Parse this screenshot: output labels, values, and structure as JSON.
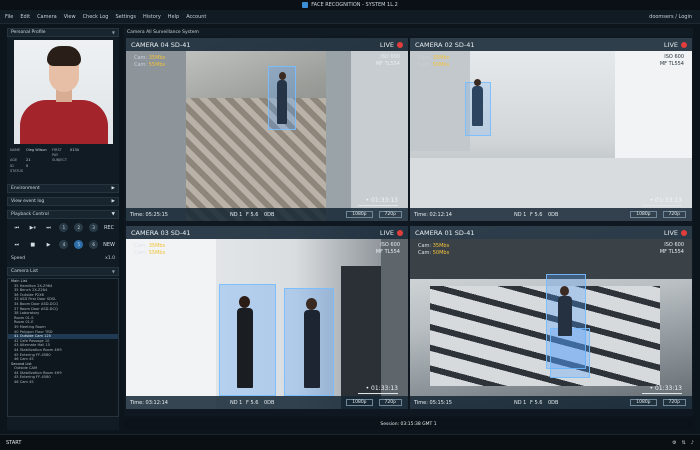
{
  "app": {
    "title": "FACE RECOGNITION - SYSTEM 1L.2",
    "user": "doomsers / Login"
  },
  "menu": [
    "File",
    "Edit",
    "Camera",
    "View",
    "Check Log",
    "Settings",
    "History",
    "Help",
    "Account"
  ],
  "left": {
    "profile_title": "Personal Profile",
    "info": [
      [
        "NAME",
        "Oleg Wilson",
        "FIRST PAY",
        "0134"
      ],
      [
        "AGE",
        "21",
        "SUBJECT",
        ""
      ],
      [
        "ID",
        "0",
        "",
        ""
      ],
      [
        "STATUS",
        "",
        "",
        ""
      ]
    ],
    "environment": "Environment",
    "view_event": "View event log",
    "playback": "Playback Control",
    "transport_row1": [
      "⏮",
      "▶⏸",
      "⏭",
      "1",
      "2",
      "3",
      "REC"
    ],
    "transport_row2": [
      "⏭",
      "■",
      "▶",
      "4",
      "5",
      "6",
      "NEW"
    ],
    "speed_label": "Speed",
    "speed_value": "x1.0",
    "camera_list_title": "Camera List",
    "camera_list": [
      {
        "label": "Main List",
        "grp": true
      },
      {
        "label": "35 Hamilton 2X-Z964"
      },
      {
        "label": "35 Bench 2X-Z264"
      },
      {
        "label": "36 Outside P2X6"
      },
      {
        "label": "33 ASD First Door SDSL"
      },
      {
        "label": "34 Boom Door ASD-DCQ"
      },
      {
        "label": "37 Room Door ASD-DCQ"
      },
      {
        "label": "38 Laboratory"
      },
      {
        "label": "Room 01-S"
      },
      {
        "label": "Room 01-E"
      },
      {
        "label": "39 Meeting Room"
      },
      {
        "label": "40 Polygon Floor TBD"
      },
      {
        "label": "41 Outside Cam 125",
        "sel": true
      },
      {
        "label": "42 Cafe Passage 10"
      },
      {
        "label": "43 Alternate Hall 15"
      },
      {
        "label": "44 Stabilization Room 4H9"
      },
      {
        "label": "45 Entering FF-4580"
      },
      {
        "label": "46 Cam 45"
      },
      {
        "label": "Second List",
        "grp": true
      },
      {
        "label": "Outside CAM"
      },
      {
        "label": "44 Stabilization Room 4H9"
      },
      {
        "label": "45 Entering FF-4580"
      },
      {
        "label": "46 Cam 45"
      }
    ]
  },
  "main": {
    "header": "Camera All Surveillance System"
  },
  "cameras": [
    {
      "name": "CAMERA 04 SD-41",
      "live": "LIVE",
      "cam1": "Cam:",
      "val1": "35Mbs",
      "cam2": "Cam:",
      "val2": "55Mbs",
      "iso": "ISO 600",
      "mf": "MF TL554",
      "time": "Time: 05:25:15",
      "nd": "ND 1",
      "f": "F 5.6",
      "odb": "0DB",
      "res1": "1080p",
      "res2": "720p",
      "tc": "• 01:33:13"
    },
    {
      "name": "CAMERA 02 SD-41",
      "live": "LIVE",
      "cam1": "Cam:",
      "val1": "35Mbs",
      "cam2": "Cam:",
      "val2": "50Mbs",
      "iso": "ISO 600",
      "mf": "MF TL554",
      "time": "Time: 02:12:14",
      "nd": "ND 1",
      "f": "F 5.6",
      "odb": "0DB",
      "res1": "1080p",
      "res2": "720p",
      "tc": "• 01:33:13"
    },
    {
      "name": "CAMERA 03 SD-41",
      "live": "LIVE",
      "cam1": "Cam:",
      "val1": "35Mbs",
      "cam2": "Cam:",
      "val2": "55Mbs",
      "iso": "ISO 600",
      "mf": "MF TL554",
      "time": "Time: 03:12:14",
      "nd": "ND 1",
      "f": "F 5.6",
      "odb": "0DB",
      "res1": "1080p",
      "res2": "720p",
      "tc": "• 01:33:13"
    },
    {
      "name": "CAMERA 01 SD-41",
      "live": "LIVE",
      "cam1": "Cam:",
      "val1": "35Mbs",
      "cam2": "Cam:",
      "val2": "50Mbs",
      "iso": "ISO 600",
      "mf": "MF TL554",
      "time": "Time: 05:15:15",
      "nd": "ND 1",
      "f": "F 5.6",
      "odb": "0DB",
      "res1": "1080p",
      "res2": "720p",
      "tc": "• 01:33:13"
    }
  ],
  "statusbar": {
    "session": "Session: 03:15:38 GMT 1"
  },
  "taskbar": {
    "start": "START"
  },
  "colors": {
    "accent": "#2d6ea8",
    "live_dot": "#e23d3d",
    "stat_yellow": "#f2c33a",
    "target_blue": "#50a0ff"
  }
}
